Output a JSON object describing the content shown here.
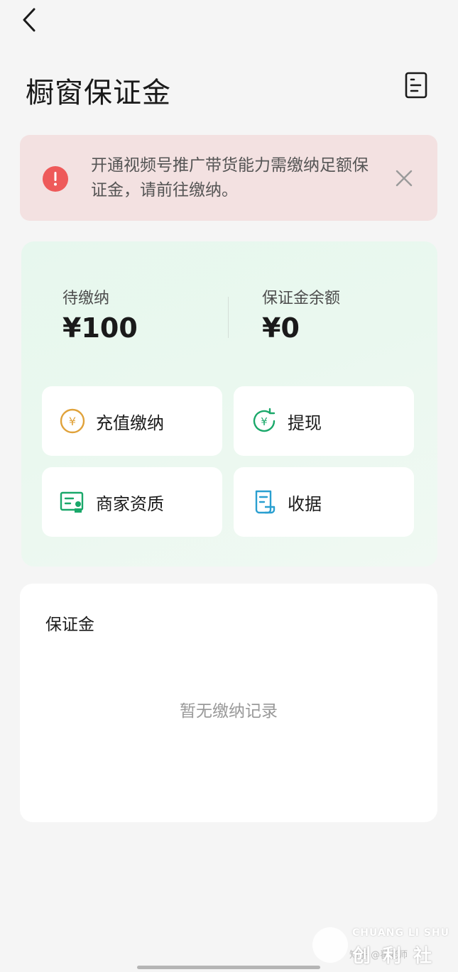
{
  "header": {
    "title": "橱窗保证金",
    "back_icon": "chevron-left-icon",
    "doc_icon": "document-list-icon"
  },
  "alert": {
    "text": "开通视频号推广带货能力需缴纳足额保证金，请前往缴纳。",
    "icon": "exclamation-icon",
    "close_icon": "close-icon",
    "colors": {
      "background": "#f3e1e1",
      "icon": "#ee5a5a"
    }
  },
  "summary": {
    "pending_label": "待缴纳",
    "pending_value": "¥100",
    "balance_label": "保证金余额",
    "balance_value": "¥0",
    "actions": [
      {
        "label": "充值缴纳",
        "icon": "yuan-coin-icon",
        "color": "#e0a23a"
      },
      {
        "label": "提现",
        "icon": "yuan-refresh-icon",
        "color": "#1aa86a"
      },
      {
        "label": "商家资质",
        "icon": "certificate-icon",
        "color": "#1aa86a"
      },
      {
        "label": "收据",
        "icon": "receipt-icon",
        "color": "#2a9fd0"
      }
    ]
  },
  "records": {
    "title": "保证金",
    "empty_text": "暂无缴纳记录"
  },
  "watermark": {
    "en": "CHUANG LI SHU",
    "cn": "创 利 社",
    "zhihu": "知乎 @翟老师"
  }
}
